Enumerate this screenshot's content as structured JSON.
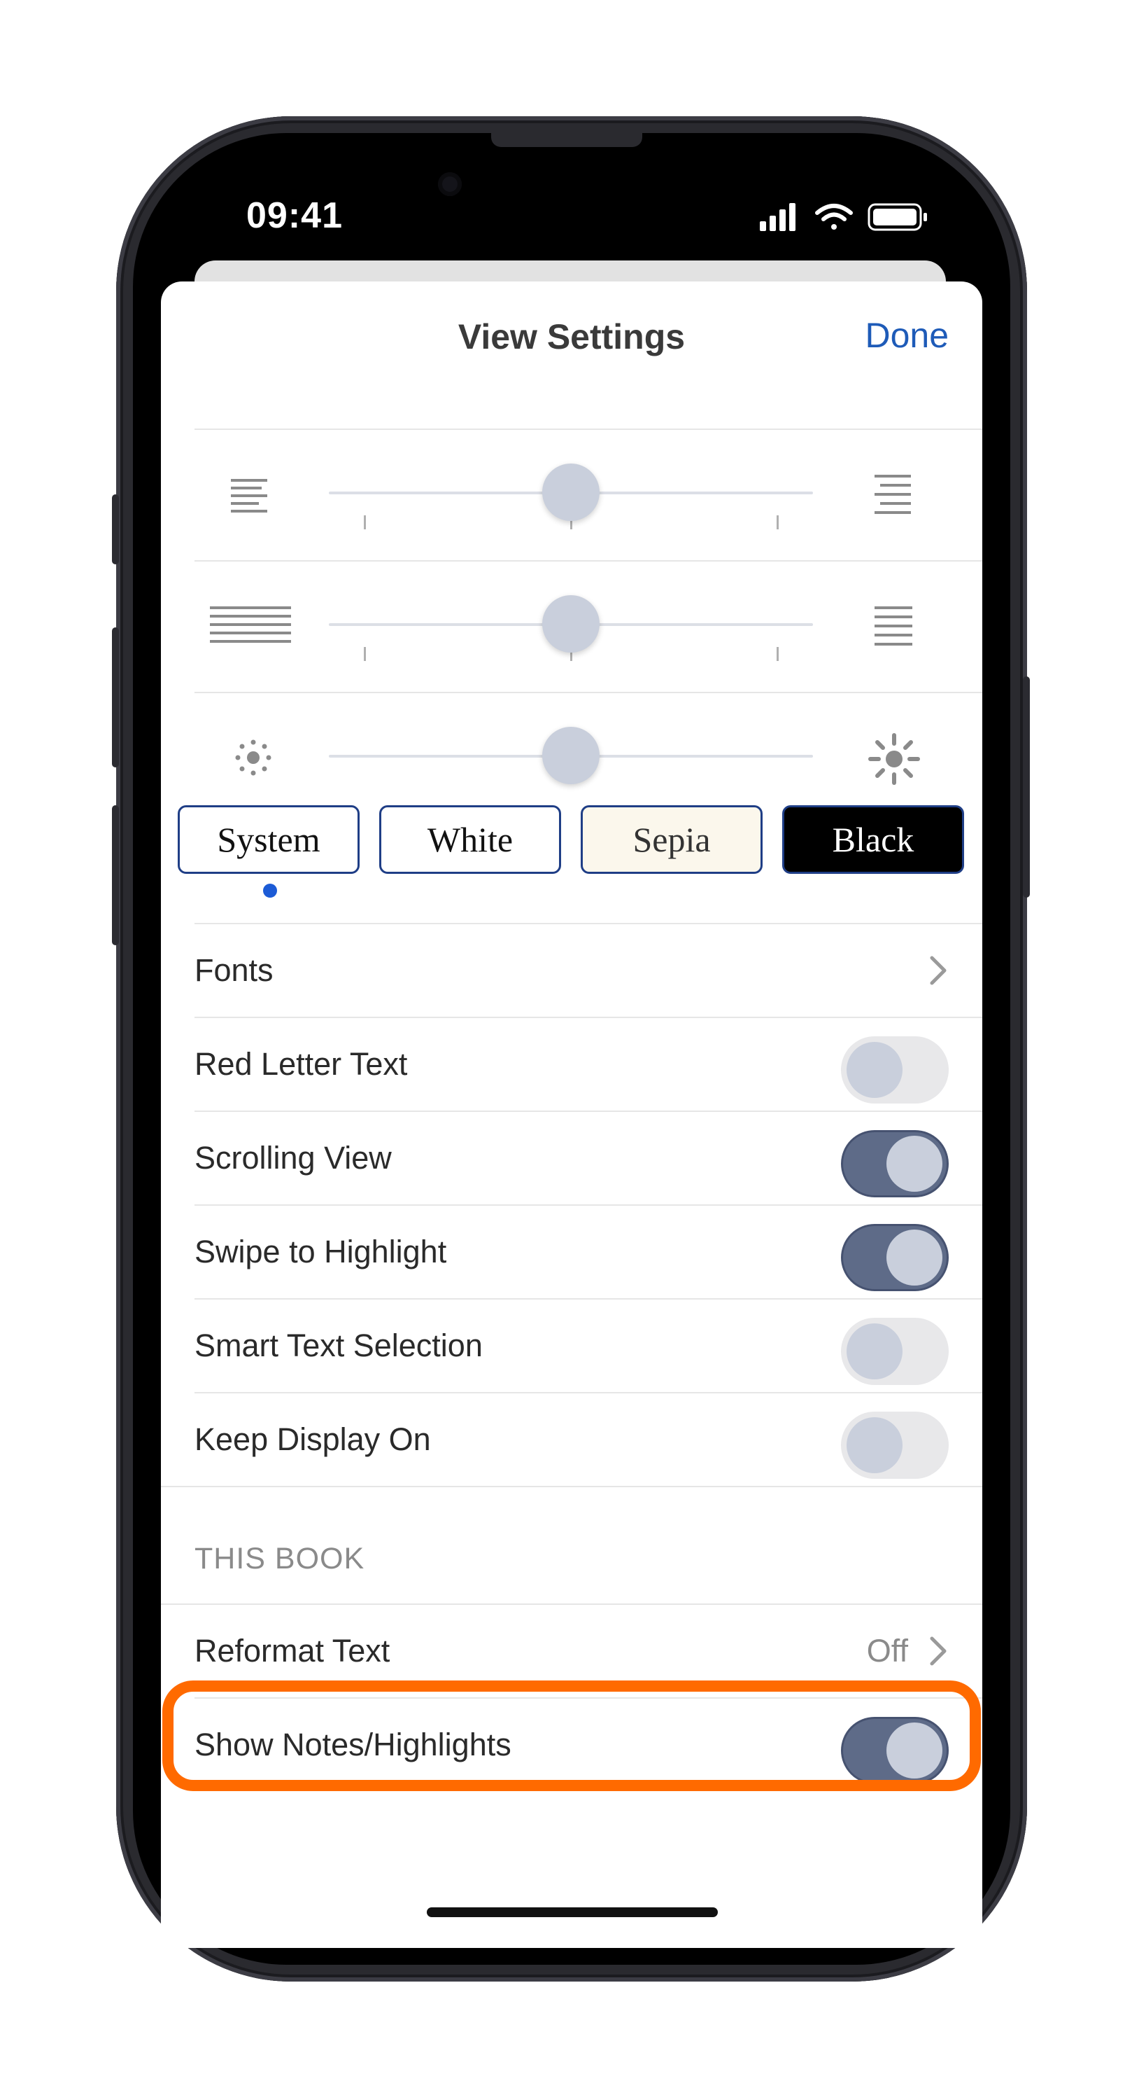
{
  "status_bar": {
    "time": "09:41"
  },
  "sheet": {
    "title": "View Settings",
    "done_label": "Done"
  },
  "themes": [
    {
      "label": "System",
      "selected": true
    },
    {
      "label": "White",
      "selected": false
    },
    {
      "label": "Sepia",
      "selected": false
    },
    {
      "label": "Black",
      "selected": false
    }
  ],
  "sliders": [
    {
      "name": "margin",
      "left_icon": "narrow-text-icon",
      "right_icon": "wide-text-icon",
      "value": 0.5
    },
    {
      "name": "line-spacing",
      "left_icon": "tight-lines-icon",
      "right_icon": "loose-lines-icon",
      "value": 0.5
    },
    {
      "name": "brightness",
      "left_icon": "dim-sun-icon",
      "right_icon": "bright-sun-icon",
      "value": 0.5
    }
  ],
  "settings": {
    "fonts": "Fonts",
    "red_letter": {
      "label": "Red Letter Text",
      "on": false
    },
    "scrolling": {
      "label": "Scrolling View",
      "on": true
    },
    "swipe": {
      "label": "Swipe to Highlight",
      "on": true
    },
    "smart": {
      "label": "Smart Text Selection",
      "on": false
    },
    "keep_display": {
      "label": "Keep Display On",
      "on": false
    }
  },
  "this_book": {
    "header": "THIS BOOK",
    "reformat": {
      "label": "Reformat Text",
      "value": "Off"
    },
    "show_notes": {
      "label": "Show Notes/Highlights",
      "on": true
    }
  },
  "colors": {
    "accent": "#1e5bb8",
    "toggle_on": "#5e6b88",
    "highlight": "#ff6a00"
  }
}
